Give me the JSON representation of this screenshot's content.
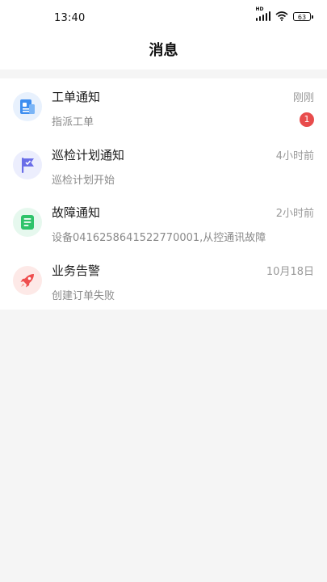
{
  "status_bar": {
    "time": "13:40",
    "battery": "63",
    "signal_label": "HD"
  },
  "header": {
    "title": "消息"
  },
  "messages": [
    {
      "title": "工单通知",
      "subtitle": "指派工单",
      "time": "刚刚",
      "badge": "1",
      "icon": "work-order-icon",
      "icon_color": "#3e8ef0"
    },
    {
      "title": "巡检计划通知",
      "subtitle": "巡检计划开始",
      "time": "4小时前",
      "badge": "",
      "icon": "flag-icon",
      "icon_color": "#6a6ee8"
    },
    {
      "title": "故障通知",
      "subtitle": "设备0416258641522770001,从控通讯故障",
      "time": "2小时前",
      "badge": "",
      "icon": "fault-list-icon",
      "icon_color": "#2fc36a"
    },
    {
      "title": "业务告警",
      "subtitle": "创建订单失败",
      "time": "10月18日",
      "badge": "",
      "icon": "rocket-icon",
      "icon_color": "#ef4f4f"
    }
  ]
}
